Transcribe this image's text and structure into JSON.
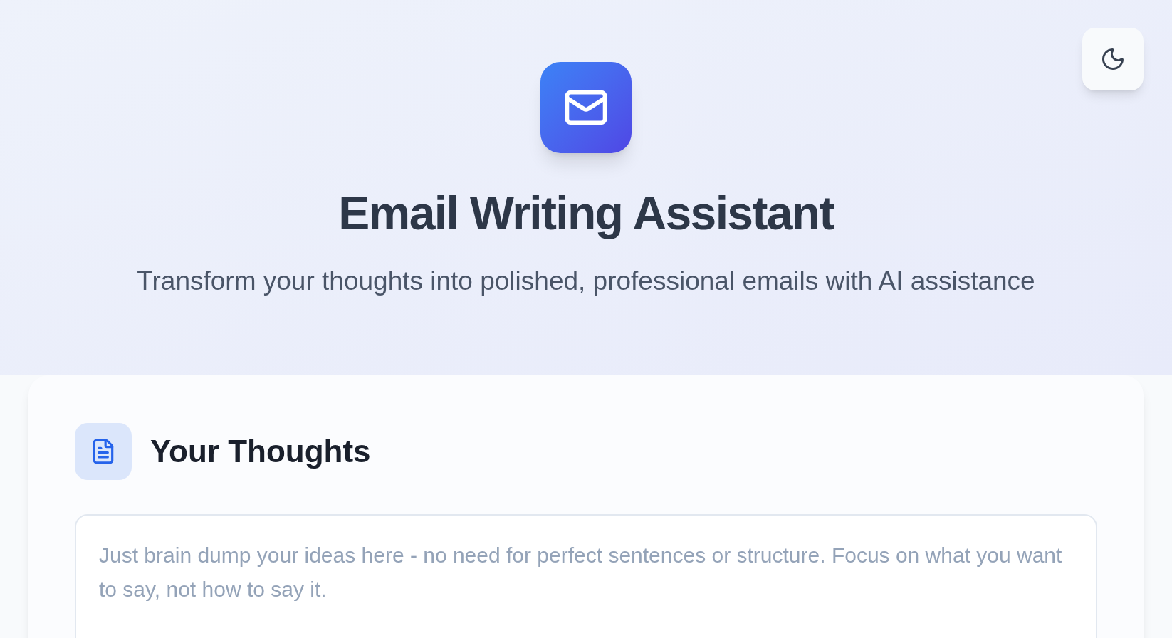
{
  "header": {
    "title": "Email Writing Assistant",
    "subtitle": "Transform your thoughts into polished, professional emails with AI assistance"
  },
  "theme_toggle": {
    "dark": false
  },
  "thoughts_card": {
    "title": "Your Thoughts",
    "input": {
      "placeholder": "Just brain dump your ideas here - no need for perfect sentences or structure. Focus on what you want to say, not how to say it."
    }
  }
}
